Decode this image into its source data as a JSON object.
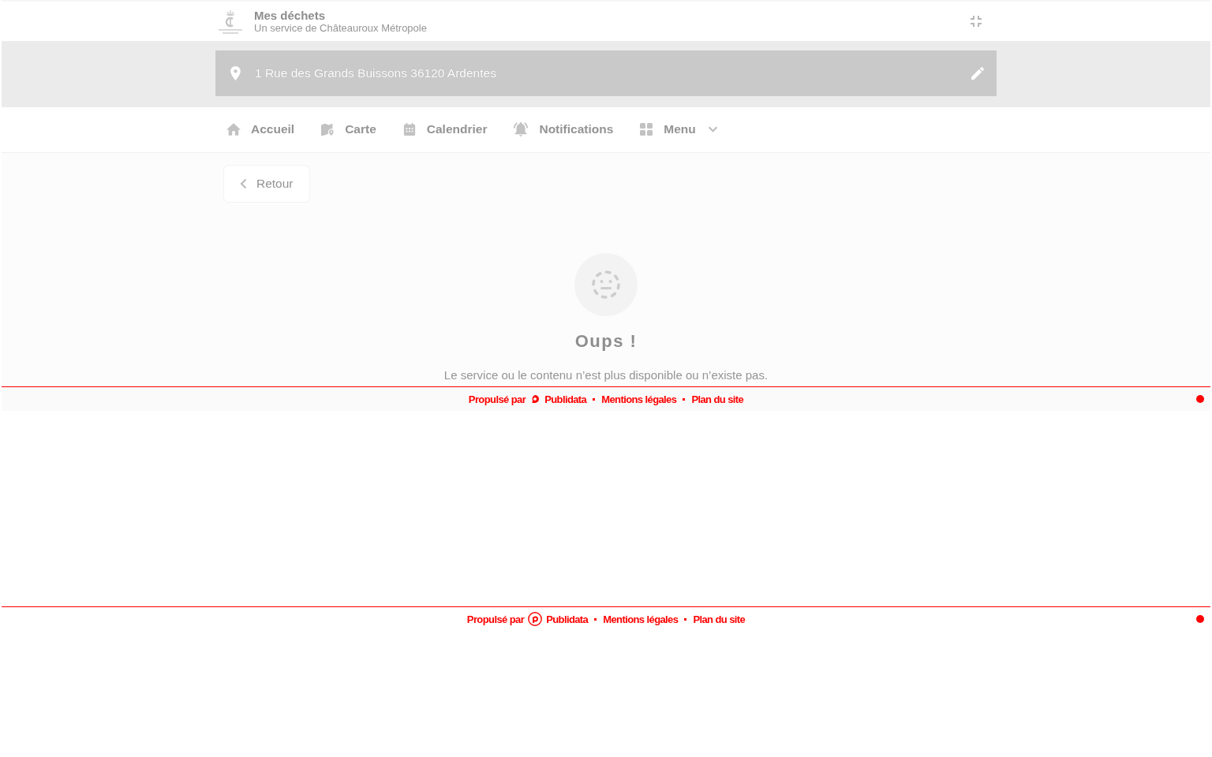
{
  "header": {
    "title": "Mes déchets",
    "subtitle": "Un service de Châteauroux Métropole"
  },
  "address_bar": {
    "address": "1 Rue des Grands Buissons 36120 Ardentes"
  },
  "nav": {
    "items": [
      {
        "label": "Accueil",
        "selected": false
      },
      {
        "label": "Carte",
        "selected": false
      },
      {
        "label": "Calendrier",
        "selected": false
      },
      {
        "label": "Notifications",
        "selected": false
      }
    ],
    "menu": {
      "label": "Menu",
      "expanded": false
    }
  },
  "back_button": {
    "label": "Retour"
  },
  "error": {
    "title": "Oups !",
    "message": "Le service ou le contenu n’est plus disponible ou n’existe pas."
  },
  "footers": [
    {
      "kind": "shaded",
      "powered_by": "Propulsé par",
      "brand": "Publidata",
      "links": [
        "Mentions légales",
        "Plan du site"
      ]
    },
    {
      "kind": "plain",
      "powered_by": "Propulsé par",
      "brand": "Publidata",
      "links": [
        "Mentions légales",
        "Plan du site"
      ]
    }
  ]
}
